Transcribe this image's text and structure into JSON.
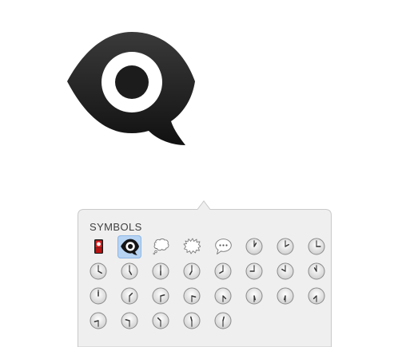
{
  "preview": {
    "emoji_name": "eye-in-speech-bubble"
  },
  "picker": {
    "section_label": "SYMBOLS",
    "selected_index": 1,
    "items": [
      {
        "name": "flag-in-hole"
      },
      {
        "name": "eye-in-speech-bubble"
      },
      {
        "name": "thought-bubble"
      },
      {
        "name": "anger-bubble"
      },
      {
        "name": "speech-bubble"
      },
      {
        "name": "clock-face-1",
        "hour": 1,
        "half": false
      },
      {
        "name": "clock-face-2",
        "hour": 2,
        "half": false
      },
      {
        "name": "clock-face-3",
        "hour": 3,
        "half": false
      },
      {
        "name": "clock-face-4",
        "hour": 4,
        "half": false
      },
      {
        "name": "clock-face-5",
        "hour": 5,
        "half": false
      },
      {
        "name": "clock-face-6",
        "hour": 6,
        "half": false
      },
      {
        "name": "clock-face-7",
        "hour": 7,
        "half": false
      },
      {
        "name": "clock-face-8",
        "hour": 8,
        "half": false
      },
      {
        "name": "clock-face-9",
        "hour": 9,
        "half": false
      },
      {
        "name": "clock-face-10",
        "hour": 10,
        "half": false
      },
      {
        "name": "clock-face-11",
        "hour": 11,
        "half": false
      },
      {
        "name": "clock-face-12",
        "hour": 12,
        "half": false
      },
      {
        "name": "clock-face-1-30",
        "hour": 1,
        "half": true
      },
      {
        "name": "clock-face-2-30",
        "hour": 2,
        "half": true
      },
      {
        "name": "clock-face-3-30",
        "hour": 3,
        "half": true
      },
      {
        "name": "clock-face-4-30",
        "hour": 4,
        "half": true
      },
      {
        "name": "clock-face-5-30",
        "hour": 5,
        "half": true
      },
      {
        "name": "clock-face-6-30",
        "hour": 6,
        "half": true
      },
      {
        "name": "clock-face-7-30",
        "hour": 7,
        "half": true
      },
      {
        "name": "clock-face-8-30",
        "hour": 8,
        "half": true
      },
      {
        "name": "clock-face-9-30",
        "hour": 9,
        "half": true
      },
      {
        "name": "clock-face-10-30",
        "hour": 10,
        "half": true
      },
      {
        "name": "clock-face-11-30",
        "hour": 11,
        "half": true
      },
      {
        "name": "clock-face-12-30",
        "hour": 12,
        "half": true
      }
    ]
  },
  "colors": {
    "popover_bg": "#efefef",
    "popover_border": "#c9c9c9",
    "selection_bg": "#b7d4f3"
  }
}
